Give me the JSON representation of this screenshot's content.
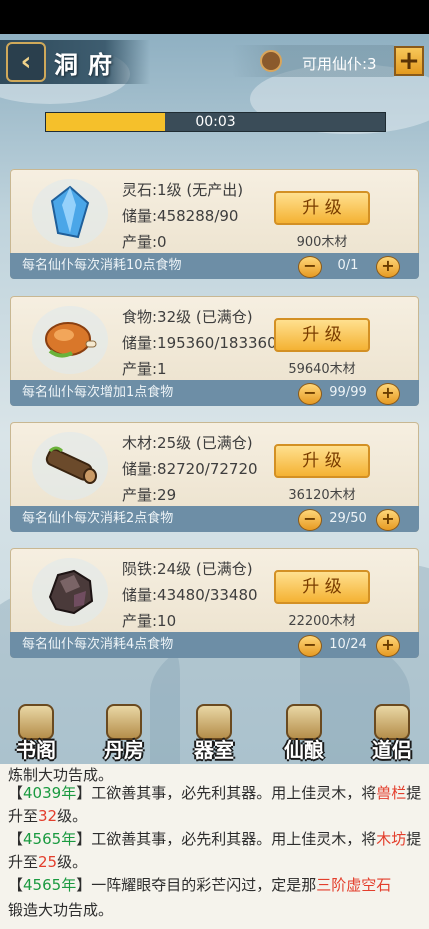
{
  "header": {
    "title": "洞府",
    "servant_label": "可用仙仆:3",
    "add_symbol": "+"
  },
  "timer": {
    "text": "00:03",
    "progress": 0.35
  },
  "cards": [
    {
      "name": "灵石:1级 (无产出)",
      "storage": "储量:458288/90",
      "output": "产量:0",
      "upgrade": "升 级",
      "cost": "900木材",
      "desc": "每名仙仆每次消耗10点食物",
      "count": "0/1",
      "icon": "spirit-stone-icon",
      "color": "#4aa6e8"
    },
    {
      "name": "食物:32级 (已满仓)",
      "storage": "储量:195360/183360",
      "output": "产量:1",
      "upgrade": "升 级",
      "cost": "59640木材",
      "desc": "每名仙仆每次增加1点食物",
      "count": "99/99",
      "icon": "roast-meat-icon",
      "color": "#d9772a"
    },
    {
      "name": "木材:25级 (已满仓)",
      "storage": "储量:82720/72720",
      "output": "产量:29",
      "upgrade": "升 级",
      "cost": "36120木材",
      "desc": "每名仙仆每次消耗2点食物",
      "count": "29/50",
      "icon": "wood-log-icon",
      "color": "#6b4a2b"
    },
    {
      "name": "陨铁:24级 (已满仓)",
      "storage": "储量:43480/33480",
      "output": "产量:10",
      "upgrade": "升 级",
      "cost": "22200木材",
      "desc": "每名仙仆每次消耗4点食物",
      "count": "10/24",
      "icon": "meteor-iron-icon",
      "color": "#4a3a3a"
    }
  ],
  "menu": [
    {
      "label": "书阁",
      "icon": "scroll-icon"
    },
    {
      "label": "丹房",
      "icon": "cauldron-icon"
    },
    {
      "label": "器室",
      "icon": "taiji-icon"
    },
    {
      "label": "仙酿",
      "icon": "wine-jar-icon"
    },
    {
      "label": "道侣",
      "icon": "flame-icon"
    }
  ],
  "log": {
    "partial": "炼制大功告成。",
    "entries": [
      {
        "open": "【",
        "year": "4039年",
        "close": "】",
        "text": "工欲善其事，必先利其器。用上佳灵木，将",
        "highlight": "兽栏",
        "mid": "提升至",
        "level": "32",
        "end": "级。"
      },
      {
        "open": "【",
        "year": "4565年",
        "close": "】",
        "text": "工欲善其事，必先利其器。用上佳灵木，将",
        "highlight": "木坊",
        "mid": "提升至",
        "level": "25",
        "end": "级。"
      },
      {
        "open": "【",
        "year": "4565年",
        "close": "】",
        "text": "一阵耀眼夺目的彩芒闪过，定是那",
        "highlight": "三阶虚空石",
        "mid": "",
        "level": "",
        "end": ""
      }
    ],
    "last": "锻造大功告成。"
  }
}
